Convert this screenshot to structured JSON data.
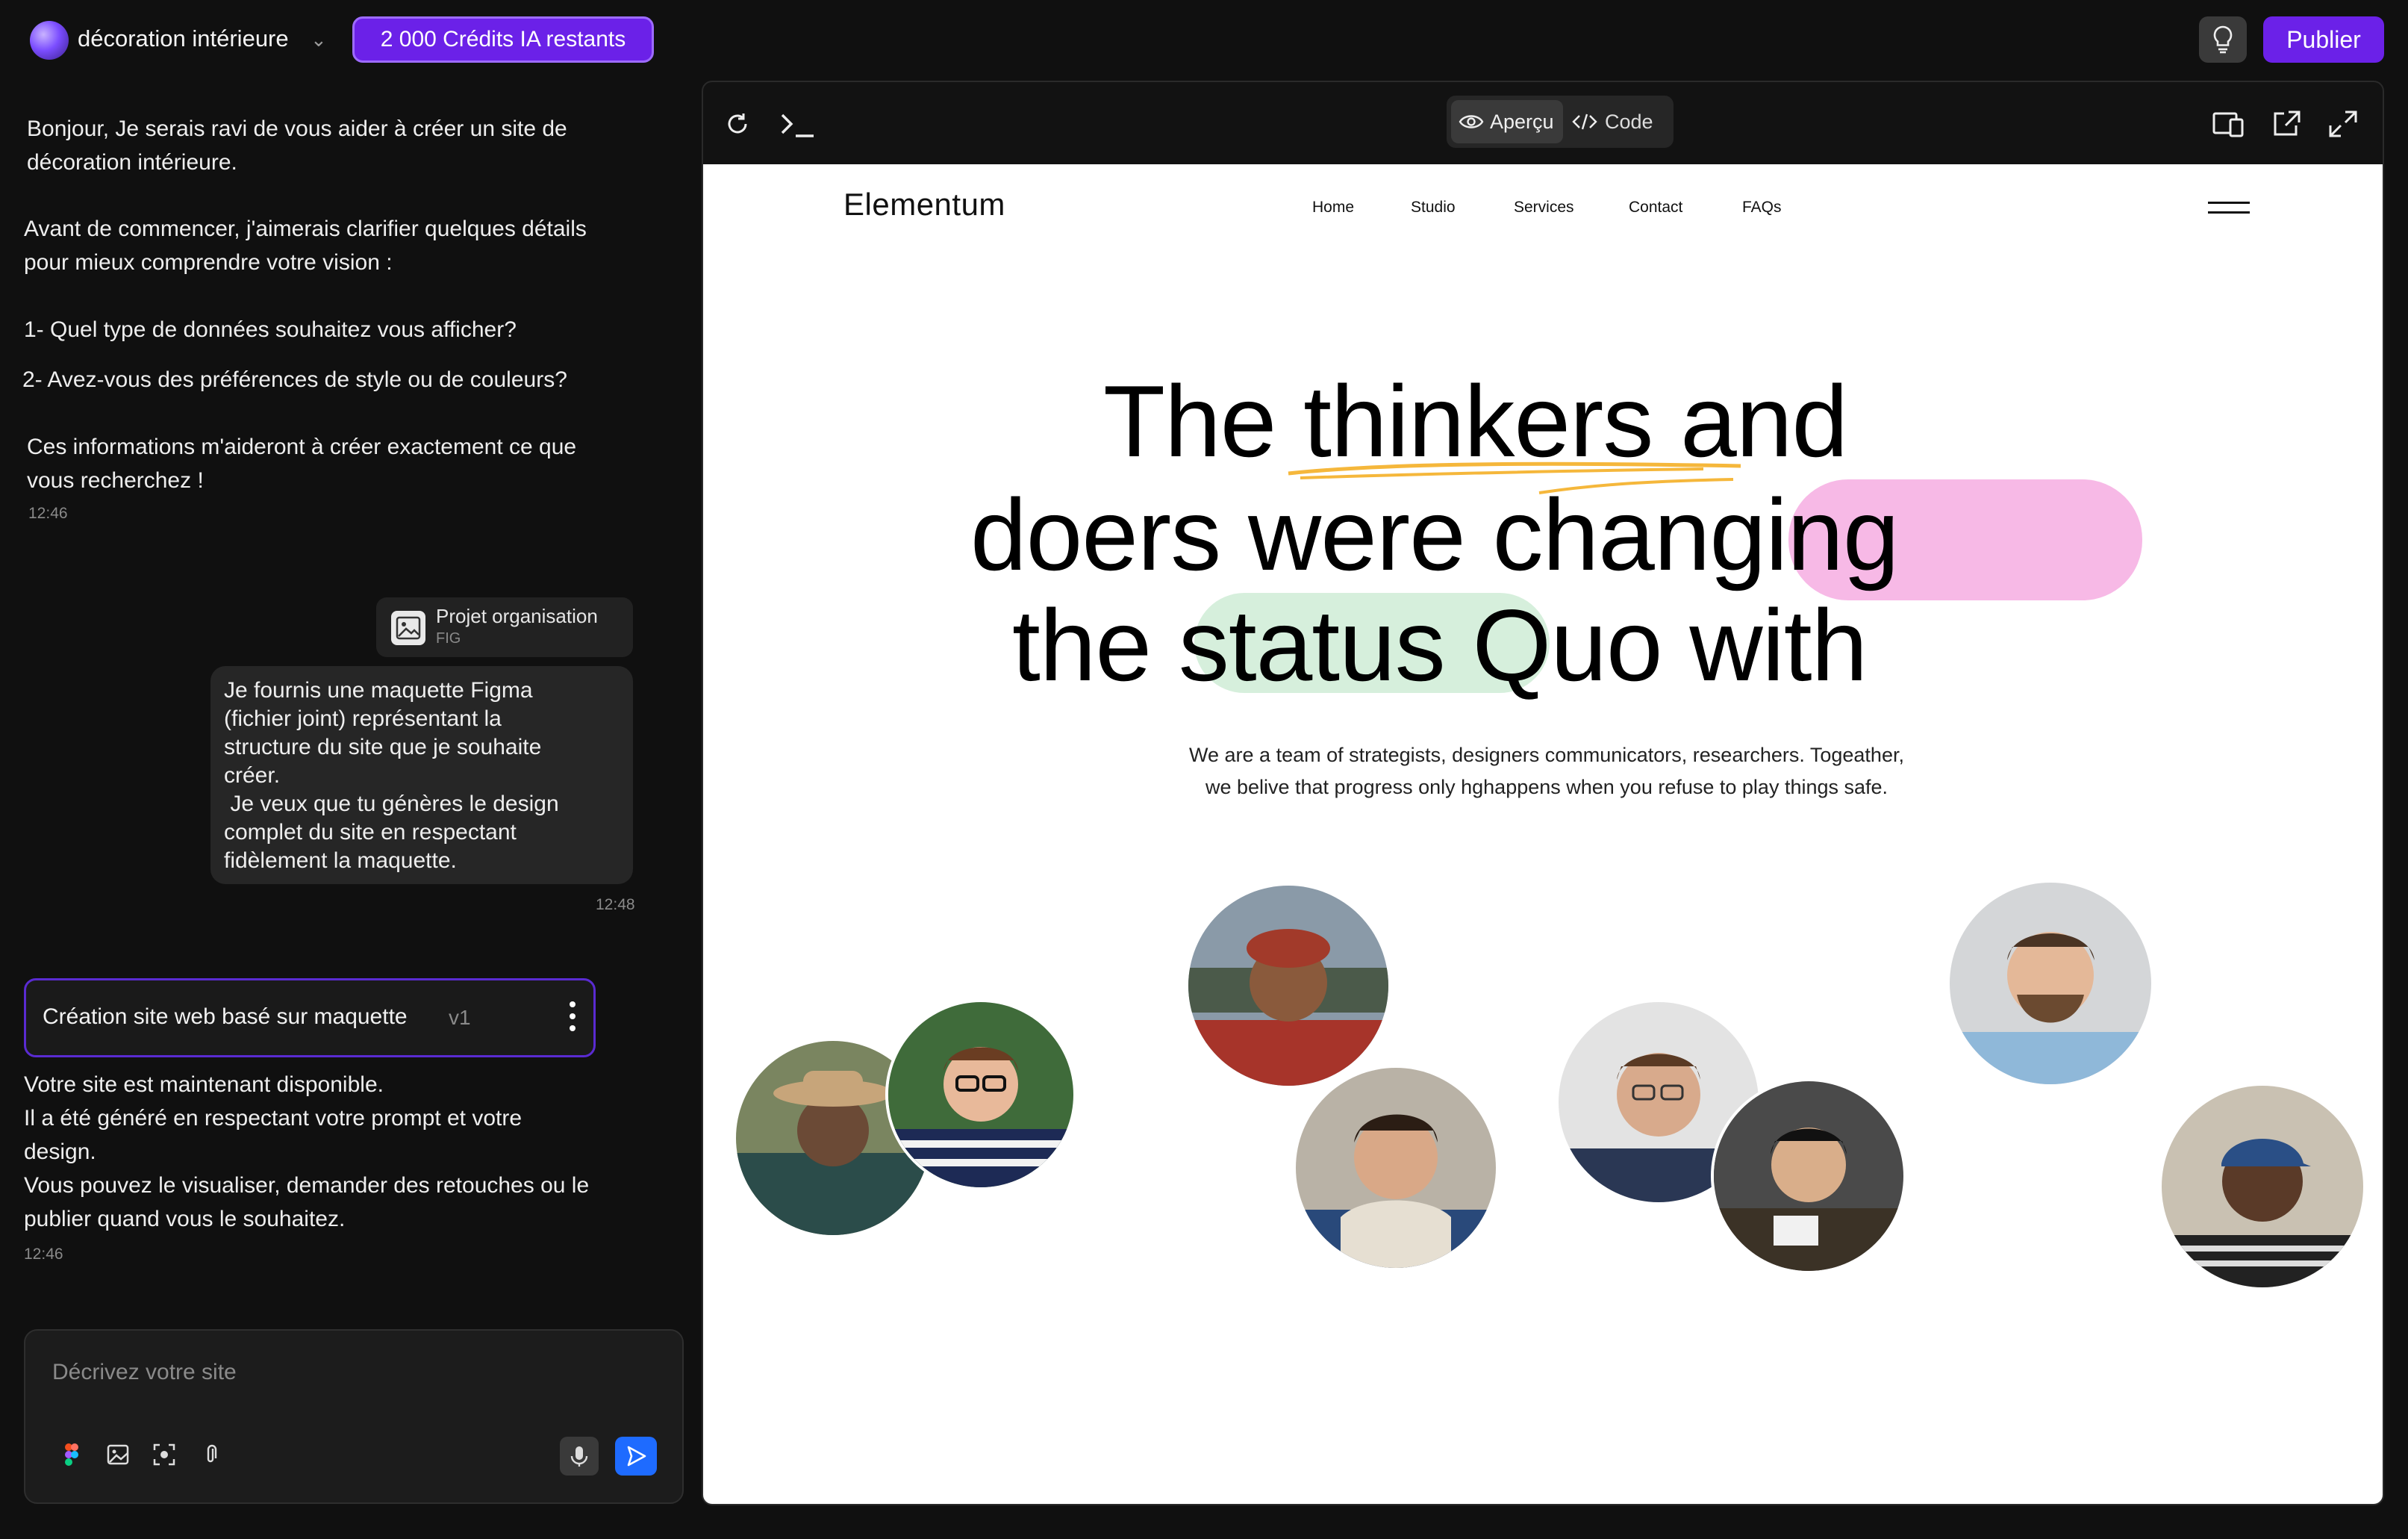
{
  "header": {
    "project_name": "décoration intérieure",
    "credits": "2 000 Crédits IA restants",
    "publish": "Publier",
    "brand_color": "#6b21e8"
  },
  "chat": {
    "assistant_msg1": [
      "Bonjour, Je serais ravi de vous aider à créer un site de",
      "décoration intérieure.",
      "Avant de commencer, j'aimerais clarifier quelques détails",
      "pour mieux comprendre votre vision :",
      "1- Quel type de données souhaitez vous afficher?",
      "2- Avez-vous des préférences de style ou de couleurs?",
      "Ces informations m'aideront à créer exactement ce que",
      "vous recherchez !"
    ],
    "time1": "12:46",
    "attachment": {
      "name": "Projet organisation",
      "type": "FIG"
    },
    "user_msg": [
      "Je fournis une maquette Figma",
      "(fichier joint) représentant la",
      "structure du site que je souhaite",
      "créer.",
      " Je veux que tu génères le design",
      "complet du site en respectant",
      "fidèlement la maquette."
    ],
    "time2": "12:48",
    "version": {
      "title": "Création site web basé sur maquette",
      "tag": "v1"
    },
    "assistant_msg2": [
      "Votre site est maintenant disponible.",
      "Il a été généré en respectant votre prompt et votre",
      "design.",
      "Vous pouvez le visualiser, demander des retouches ou le",
      "publier quand vous le souhaitez."
    ],
    "time3": "12:46"
  },
  "composer": {
    "placeholder": "Décrivez votre site",
    "icons": [
      "figma-icon",
      "image-icon",
      "screenshot-icon",
      "paperclip-icon",
      "mic-icon",
      "send-icon"
    ]
  },
  "preview": {
    "tabs": [
      "Aperçu",
      "Code"
    ],
    "active_tab": "Aperçu",
    "toolbar_icons": [
      "refresh-icon",
      "terminal-icon",
      "responsive-icon",
      "external-link-icon",
      "expand-icon"
    ]
  },
  "website": {
    "logo": "Elementum",
    "nav": [
      "Home",
      "Studio",
      "Services",
      "Contact",
      "FAQs"
    ],
    "hero": {
      "line1_a": "The",
      "line1_b": "thinkers",
      "line1_c": "and",
      "line2_a": "doers were ch",
      "line2_b": "anging",
      "line3_a": "the",
      "line3_b": "status",
      "line3_c": "Quo with"
    },
    "subtitle": [
      "We are a team of strategists, designers communicators, researchers. Togeather,",
      "we belive that progress only hghappens when you refuse to play things safe."
    ],
    "highlight_colors": {
      "pink": "#f7b9e6",
      "green": "#d6efdc",
      "underline": "#f5b73b"
    }
  }
}
